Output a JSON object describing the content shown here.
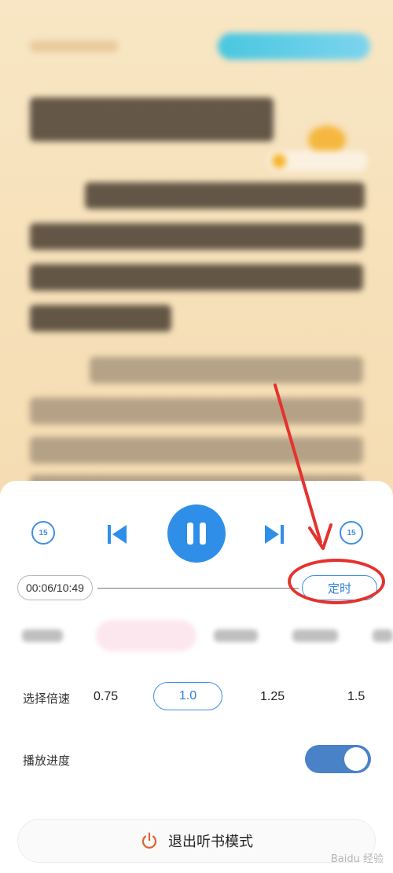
{
  "player": {
    "rewind_label": "15",
    "forward_label": "15",
    "current_time": "00:06/10:49",
    "timer_label": "定时"
  },
  "speed": {
    "label": "选择倍速",
    "options": [
      "0.75",
      "1.0",
      "1.25",
      "1.5"
    ],
    "selected": "1.0"
  },
  "playback_progress": {
    "label": "播放进度",
    "toggle_on": true
  },
  "exit": {
    "label": "退出听书模式"
  },
  "watermark": "Baidu 经验",
  "colors": {
    "accent": "#2f8fe8",
    "annotation": "#e5322d",
    "toggle": "#4a82c8",
    "page_bg": "#f6e2bd"
  },
  "icons": [
    "rewind-15-icon",
    "previous-icon",
    "pause-icon",
    "next-icon",
    "forward-15-icon",
    "power-icon"
  ]
}
